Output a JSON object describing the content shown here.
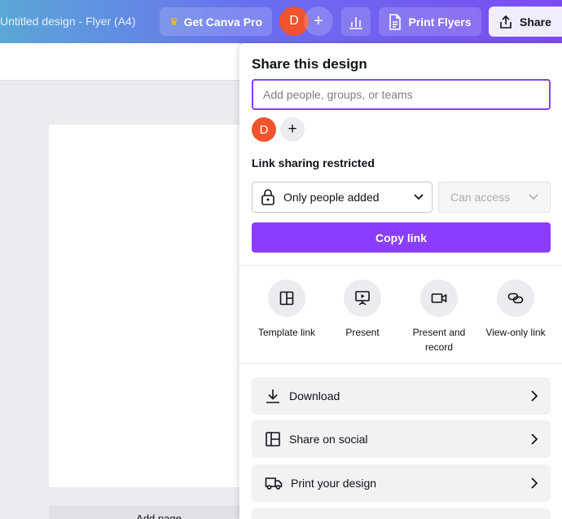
{
  "topbar": {
    "doc_title": "Untitled design - Flyer (A4)",
    "pro_label": "Get Canva Pro",
    "avatar_initial": "D",
    "add_collaborator": "+",
    "print_label": "Print Flyers",
    "share_label": "Share"
  },
  "share_panel": {
    "title": "Share this design",
    "people_input_placeholder": "Add people, groups, or teams",
    "people_input_value": "",
    "member_initial": "D",
    "add_member": "+",
    "link_heading": "Link sharing restricted",
    "access_scope": "Only people added",
    "access_level": "Can access",
    "copy_link": "Copy link",
    "quick_actions": [
      {
        "label": "Template link",
        "icon": "template-icon"
      },
      {
        "label": "Present",
        "icon": "present-icon"
      },
      {
        "label": "Present and record",
        "icon": "video-camera-icon"
      },
      {
        "label": "View-only link",
        "icon": "link-icon"
      }
    ],
    "rows": [
      {
        "label": "Download",
        "icon": "download-icon"
      },
      {
        "label": "Share on social",
        "icon": "social-icon"
      },
      {
        "label": "Print your design",
        "icon": "truck-icon"
      }
    ]
  },
  "canvas": {
    "add_page_label": "Add page"
  },
  "colors": {
    "accent": "#8b3dff",
    "avatar": "#f0532d",
    "crown": "#ffc400"
  }
}
